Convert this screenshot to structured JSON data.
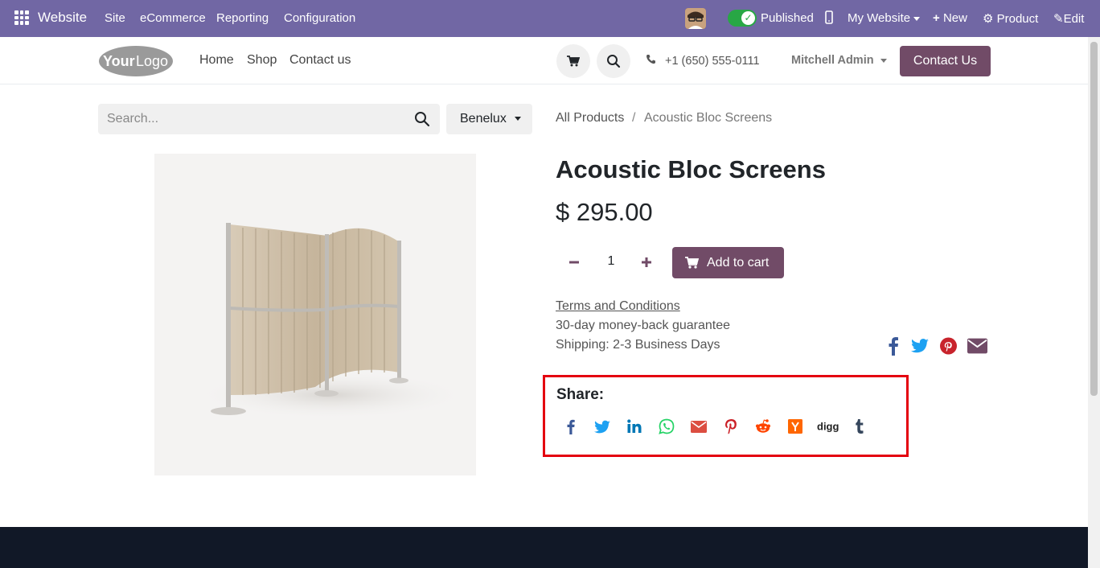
{
  "topbar": {
    "brand": "Website",
    "menu": [
      "Site",
      "eCommerce",
      "Reporting",
      "Configuration"
    ],
    "published_label": "Published",
    "my_website_label": "My Website",
    "new_label": "New",
    "product_label": "Product",
    "edit_label": "Edit",
    "bg_color": "#7167a4"
  },
  "header": {
    "logo_text": "YourLogo",
    "nav": [
      "Home",
      "Shop",
      "Contact us"
    ],
    "phone": "+1 (650) 555-0111",
    "user": "Mitchell Admin",
    "contact_button": "Contact Us",
    "accent_color": "#714b67"
  },
  "search": {
    "placeholder": "Search...",
    "value": ""
  },
  "pricelist": {
    "selected": "Benelux"
  },
  "breadcrumb": {
    "parent": "All Products",
    "separator": "/",
    "current": "Acoustic Bloc Screens"
  },
  "product": {
    "name": "Acoustic Bloc Screens",
    "price": "$ 295.00",
    "quantity": "1",
    "add_to_cart": "Add to cart",
    "terms": "Terms and Conditions",
    "guarantee": "30-day money-back guarantee",
    "shipping": "Shipping: 2-3 Business Days"
  },
  "social_icons": [
    "facebook-icon",
    "twitter-icon",
    "pinterest-icon",
    "envelope-icon"
  ],
  "share": {
    "label": "Share:",
    "icons": [
      "facebook-icon",
      "twitter-icon",
      "linkedin-icon",
      "whatsapp-icon",
      "email-icon",
      "pinterest-icon",
      "reddit-icon",
      "hackernews-icon",
      "digg-icon",
      "tumblr-icon"
    ],
    "digg_text": "digg",
    "highlight_color": "#e4000f"
  }
}
